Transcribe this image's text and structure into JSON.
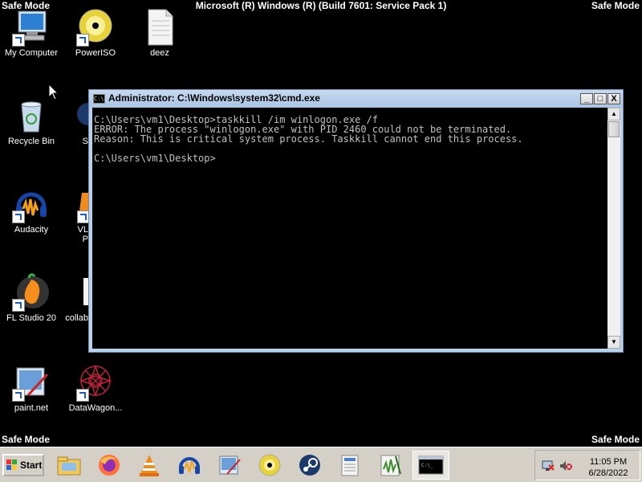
{
  "desktop": {
    "safe_mode_label": "Safe Mode",
    "build_text": "Microsoft (R) Windows (R) (Build 7601: Service Pack 1)",
    "icons": [
      {
        "label": "My Computer",
        "icon": "computer-icon"
      },
      {
        "label": "PowerISO",
        "icon": "disc-icon"
      },
      {
        "label": "deez",
        "icon": "document-icon"
      },
      {
        "label": "Recycle Bin",
        "icon": "recycle-bin-icon"
      },
      {
        "label": "Audacity",
        "icon": "audacity-icon"
      },
      {
        "label": "FL Studio 20",
        "icon": "fl-studio-icon"
      },
      {
        "label": "paint.net",
        "icon": "paint-net-icon"
      },
      {
        "label": "DataWagon...",
        "icon": "datawagon-icon"
      },
      {
        "label": "S",
        "icon": "steam-icon"
      },
      {
        "label": "VL",
        "icon": "vlc-icon"
      },
      {
        "label": "P",
        "icon": ""
      },
      {
        "label": "collab",
        "icon": "document-icon"
      }
    ]
  },
  "cmd_window": {
    "title": "Administrator: C:\\Windows\\system32\\cmd.exe",
    "minimize": "_",
    "maximize": "□",
    "close": "X",
    "console_text": "C:\\Users\\vm1\\Desktop>taskkill /im winlogon.exe /f\nERROR: The process \"winlogon.exe\" with PID 2460 could not be terminated.\nReason: This is critical system process. Taskkill cannot end this process.\n\nC:\\Users\\vm1\\Desktop>",
    "scroll_up": "▲",
    "scroll_down": "▼"
  },
  "taskbar": {
    "start_label": "Start",
    "pinned": [
      "file-explorer-icon",
      "firefox-icon",
      "vlc-icon",
      "audacity-icon",
      "paint-net-icon",
      "poweriso-icon",
      "steam-icon",
      "document-viewer-icon",
      "audio-editor-icon",
      "cmd-icon"
    ],
    "clock_time": "11:05 PM",
    "clock_date": "6/28/2022"
  }
}
